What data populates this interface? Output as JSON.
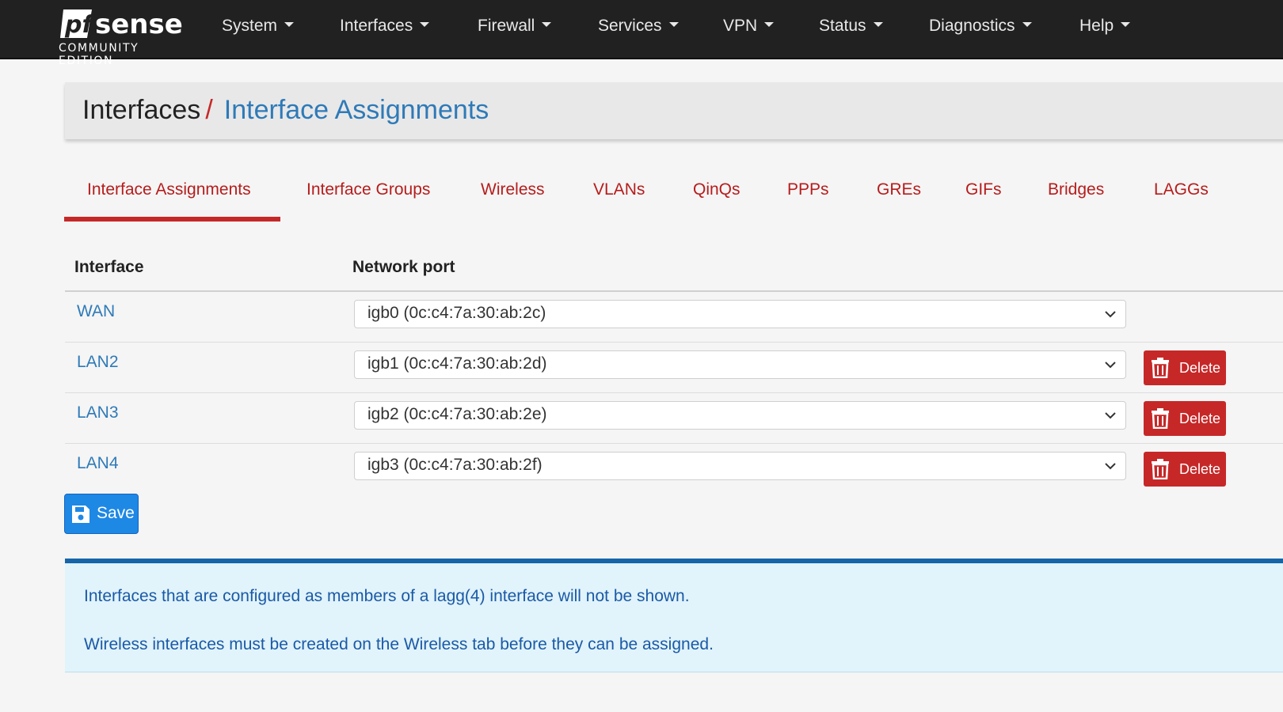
{
  "brand": {
    "logo_text": "pfsense",
    "edition": "COMMUNITY EDITION"
  },
  "nav": {
    "items": [
      {
        "label": "System"
      },
      {
        "label": "Interfaces"
      },
      {
        "label": "Firewall"
      },
      {
        "label": "Services"
      },
      {
        "label": "VPN"
      },
      {
        "label": "Status"
      },
      {
        "label": "Diagnostics"
      },
      {
        "label": "Help"
      }
    ]
  },
  "breadcrumb": {
    "parent": "Interfaces",
    "separator": "/",
    "current": "Interface Assignments"
  },
  "tabs": {
    "active": "Interface Assignments",
    "items": [
      {
        "label": "Interface Assignments"
      },
      {
        "label": "Interface Groups"
      },
      {
        "label": "Wireless"
      },
      {
        "label": "VLANs"
      },
      {
        "label": "QinQs"
      },
      {
        "label": "PPPs"
      },
      {
        "label": "GREs"
      },
      {
        "label": "GIFs"
      },
      {
        "label": "Bridges"
      },
      {
        "label": "LAGGs"
      }
    ]
  },
  "table": {
    "columns": [
      "Interface",
      "Network port"
    ],
    "rows": [
      {
        "interface": "WAN",
        "port": "igb0 (0c:c4:7a:30:ab:2c)",
        "delete_label": ""
      },
      {
        "interface": "LAN2",
        "port": "igb1 (0c:c4:7a:30:ab:2d)",
        "delete_label": "Delete"
      },
      {
        "interface": "LAN3",
        "port": "igb2 (0c:c4:7a:30:ab:2e)",
        "delete_label": "Delete"
      },
      {
        "interface": "LAN4",
        "port": "igb3 (0c:c4:7a:30:ab:2f)",
        "delete_label": "Delete"
      }
    ]
  },
  "save": {
    "label": "Save",
    "icon": "floppy-disk-icon"
  },
  "info": {
    "line1": "Interfaces that are configured as members of a lagg(4) interface will not be shown.",
    "line2": "Wireless interfaces must be created on the Wireless tab before they can be assigned."
  },
  "colors": {
    "navbar": "#212121",
    "accent_red": "#c62828",
    "link_blue": "#2e7ab8",
    "save_blue": "#1e88e5",
    "info_bg": "#e1f3fb",
    "info_border": "#1565a8"
  }
}
